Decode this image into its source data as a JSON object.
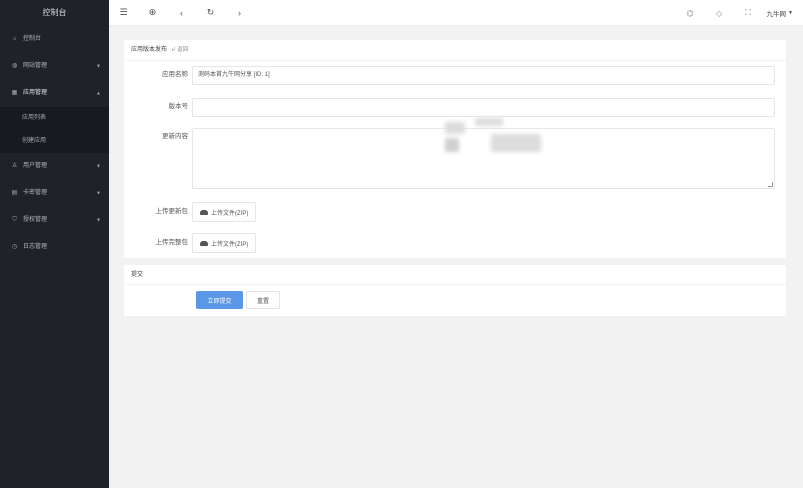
{
  "sidebar": {
    "logo": "控制台",
    "items": [
      {
        "icon": "home-icon",
        "glyph": "⌂",
        "label": "控制台",
        "arrow": ""
      },
      {
        "icon": "globe-icon",
        "glyph": "◍",
        "label": "网站管理",
        "arrow": "▼"
      },
      {
        "icon": "apps-icon",
        "glyph": "▦",
        "label": "应用管理",
        "arrow": "▲"
      },
      {
        "icon": "user-icon",
        "glyph": "♙",
        "label": "用户管理",
        "arrow": "▼"
      },
      {
        "icon": "card-icon",
        "glyph": "▤",
        "label": "卡密管理",
        "arrow": "▼"
      },
      {
        "icon": "shield-icon",
        "glyph": "⛉",
        "label": "授权管理",
        "arrow": "▼"
      },
      {
        "icon": "clock-icon",
        "glyph": "◷",
        "label": "日志管理",
        "arrow": ""
      }
    ],
    "submenu": [
      "应用列表",
      "创建应用"
    ]
  },
  "header": {
    "user": "九牛网",
    "user_arrow": "▼"
  },
  "form": {
    "title": "应用版本发布",
    "back": "返回",
    "app_name_label": "应用名称",
    "app_name_value": "测码本首九牛网分享 [ID: 1]",
    "version_label": "版本号",
    "version_value": "",
    "content_label": "更新内容",
    "upload1_label": "上传更新包",
    "upload1_btn": "上传文件(ZIP)",
    "upload2_label": "上传完整包",
    "upload2_btn": "上传文件(ZIP)"
  },
  "submit": {
    "title": "提交",
    "primary": "立即提交",
    "reset": "重置"
  }
}
